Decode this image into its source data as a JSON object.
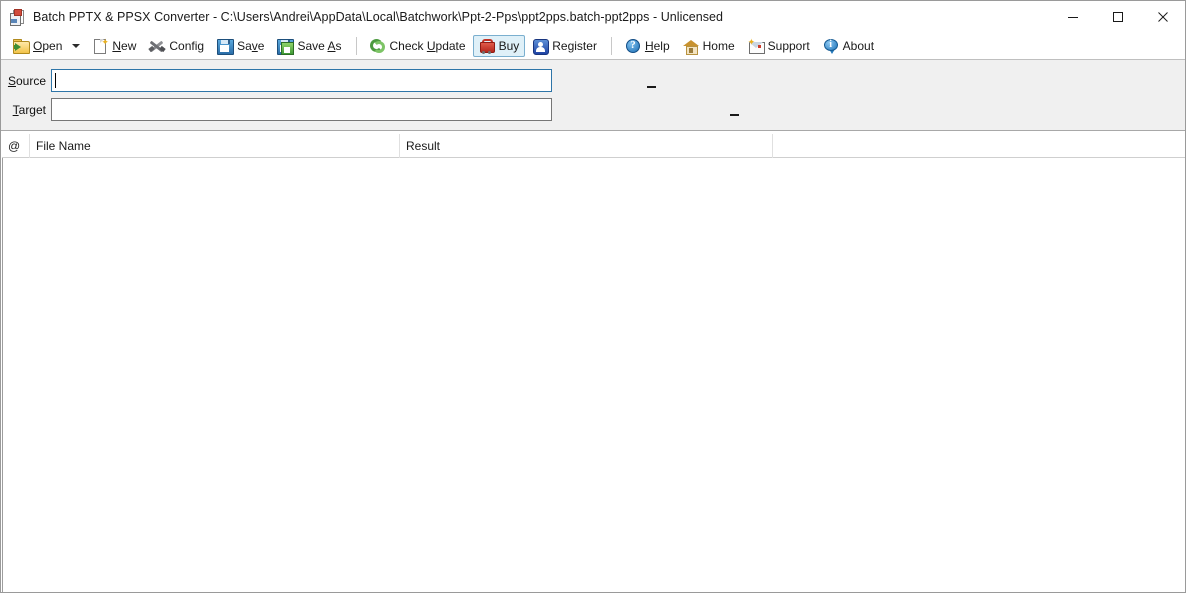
{
  "window": {
    "title": "Batch PPTX & PPSX Converter - C:\\Users\\Andrei\\AppData\\Local\\Batchwork\\Ppt-2-Pps\\ppt2pps.batch-ppt2pps - Unlicensed",
    "app_icon": "document-convert-icon",
    "controls": {
      "minimize": "minimize-icon",
      "maximize": "maximize-icon",
      "close": "close-icon"
    }
  },
  "toolbar": {
    "items": [
      {
        "label": "Open",
        "icon": "folder-open-icon",
        "underline": "O",
        "state": "normal",
        "has_dropdown": true
      },
      {
        "label": "New",
        "icon": "new-document-icon",
        "underline": "N",
        "state": "normal",
        "has_dropdown": false
      },
      {
        "label": "Config",
        "icon": "tools-icon",
        "underline": "",
        "state": "normal",
        "has_dropdown": false
      },
      {
        "label": "Save",
        "icon": "floppy-disk-icon",
        "underline": "v",
        "state": "normal",
        "has_dropdown": false
      },
      {
        "label": "Save As",
        "icon": "save-as-icon",
        "underline": "A",
        "state": "normal",
        "has_dropdown": false
      },
      {
        "label": "Check Update",
        "icon": "refresh-icon",
        "underline": "U",
        "state": "normal",
        "has_dropdown": false
      },
      {
        "label": "Buy",
        "icon": "shopping-cart-icon",
        "underline": "",
        "state": "hover",
        "has_dropdown": false
      },
      {
        "label": "Register",
        "icon": "user-register-icon",
        "underline": "",
        "state": "normal",
        "has_dropdown": false
      },
      {
        "label": "Help",
        "icon": "question-mark-icon",
        "underline": "H",
        "state": "normal",
        "has_dropdown": false
      },
      {
        "label": "Home",
        "icon": "house-icon",
        "underline": "",
        "state": "normal",
        "has_dropdown": false
      },
      {
        "label": "Support",
        "icon": "envelope-icon",
        "underline": "",
        "state": "normal",
        "has_dropdown": false
      },
      {
        "label": "About",
        "icon": "info-balloon-icon",
        "underline": "",
        "state": "normal",
        "has_dropdown": false
      }
    ],
    "labels": {
      "open": "Open",
      "new": "New",
      "config": "Config",
      "save": "Save",
      "save_as": "Save As",
      "check_update": "Check Update",
      "buy": "Buy",
      "register": "Register",
      "help": "Help",
      "home": "Home",
      "support": "Support",
      "about": "About"
    }
  },
  "path_panel": {
    "source": {
      "label": "Source",
      "value": "",
      "placeholder": "",
      "focused": true
    },
    "target": {
      "label": "Target",
      "value": "",
      "placeholder": "",
      "focused": false
    }
  },
  "file_list": {
    "columns": [
      {
        "key": "at",
        "label": "@"
      },
      {
        "key": "name",
        "label": "File Name"
      },
      {
        "key": "result",
        "label": "Result"
      }
    ],
    "rows": []
  },
  "colors": {
    "window_bg": "#ffffff",
    "panel_bg": "#f0f0f0",
    "focus_border": "#2e75a8",
    "field_border": "#767676",
    "hover_bg": "#dff0f8",
    "hover_border": "#7aafcf",
    "separator": "#c8c8c8",
    "text": "#1a1a1a"
  }
}
